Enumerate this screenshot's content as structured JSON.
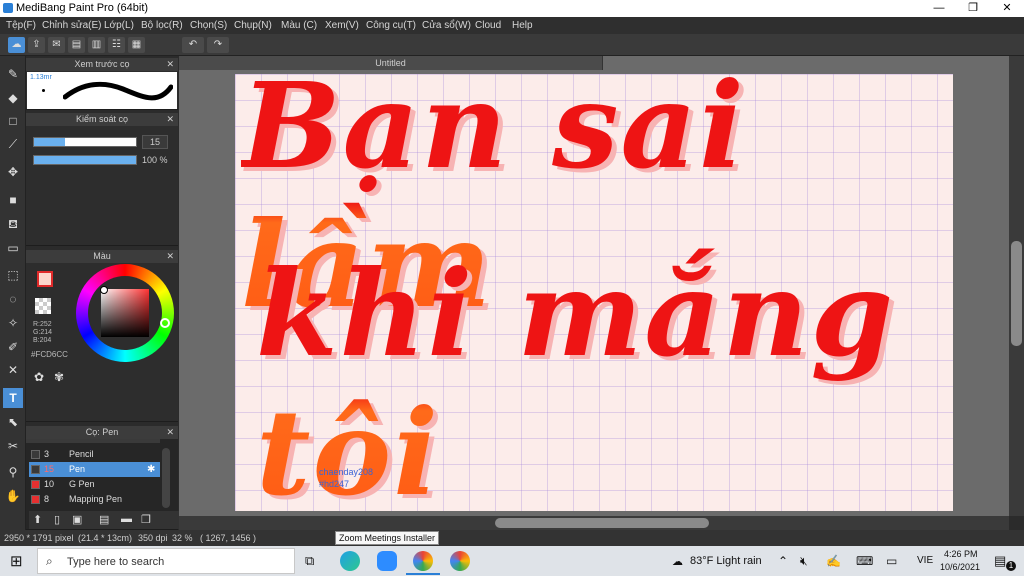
{
  "window": {
    "title": "MediBang Paint Pro (64bit)",
    "minimize": "—",
    "restore": "❐",
    "close": "✕"
  },
  "menu": [
    "Tệp(F)",
    "Chỉnh sửa(E)",
    "Lớp(L)",
    "Bộ lọc(R)",
    "Chọn(S)",
    "Chụp(N)",
    "Màu (C)",
    "Xem(V)",
    "Công cụ(T)",
    "Cửa sổ(W)",
    "Cloud",
    "Help"
  ],
  "toolbar": {
    "undo": "↶",
    "redo": "↷"
  },
  "brush_preview": {
    "title": "Xem trước cọ",
    "size_label": "1.13mr"
  },
  "brush_control": {
    "title": "Kiểm soát cọ",
    "size_value": "15",
    "opacity_value": "100 %",
    "opacity_fraction": 1.0,
    "size_fraction": 0.3
  },
  "color_panel": {
    "title": "Màu",
    "r": "R:252",
    "g": "G:214",
    "b": "B:204",
    "hex": "#FCD6CC",
    "fg_color": "#fcd6cc"
  },
  "brush_list": {
    "title": "Cọ: Pen",
    "items": [
      {
        "size": "3",
        "name": "Pencil",
        "selected": false,
        "color": "#3a3a3a"
      },
      {
        "size": "15",
        "name": "Pen",
        "selected": true,
        "color": "#3a3a3a"
      },
      {
        "size": "10",
        "name": "G Pen",
        "selected": false,
        "color": "#e53030"
      },
      {
        "size": "8",
        "name": "Mapping Pen",
        "selected": false,
        "color": "#e53030"
      }
    ]
  },
  "document": {
    "tab": "Untitled",
    "line1": "Bạn sai lầm",
    "line2": "khi mắng tôi",
    "signature1": "chaenday208",
    "signature2": "#hd247"
  },
  "status": {
    "size": "2950 * 1791 pixel",
    "dims": "(21.4 * 13cm)",
    "dpi": "350 dpi",
    "zoom": "32 %",
    "coords": "( 1267, 1456 )"
  },
  "tooltip": "Zoom Meetings Installer",
  "taskbar": {
    "search_placeholder": "Type here to search",
    "weather": "83°F  Light rain",
    "lang": "VIE",
    "time": "4:26 PM",
    "date": "10/6/2021",
    "notif_count": "1"
  }
}
